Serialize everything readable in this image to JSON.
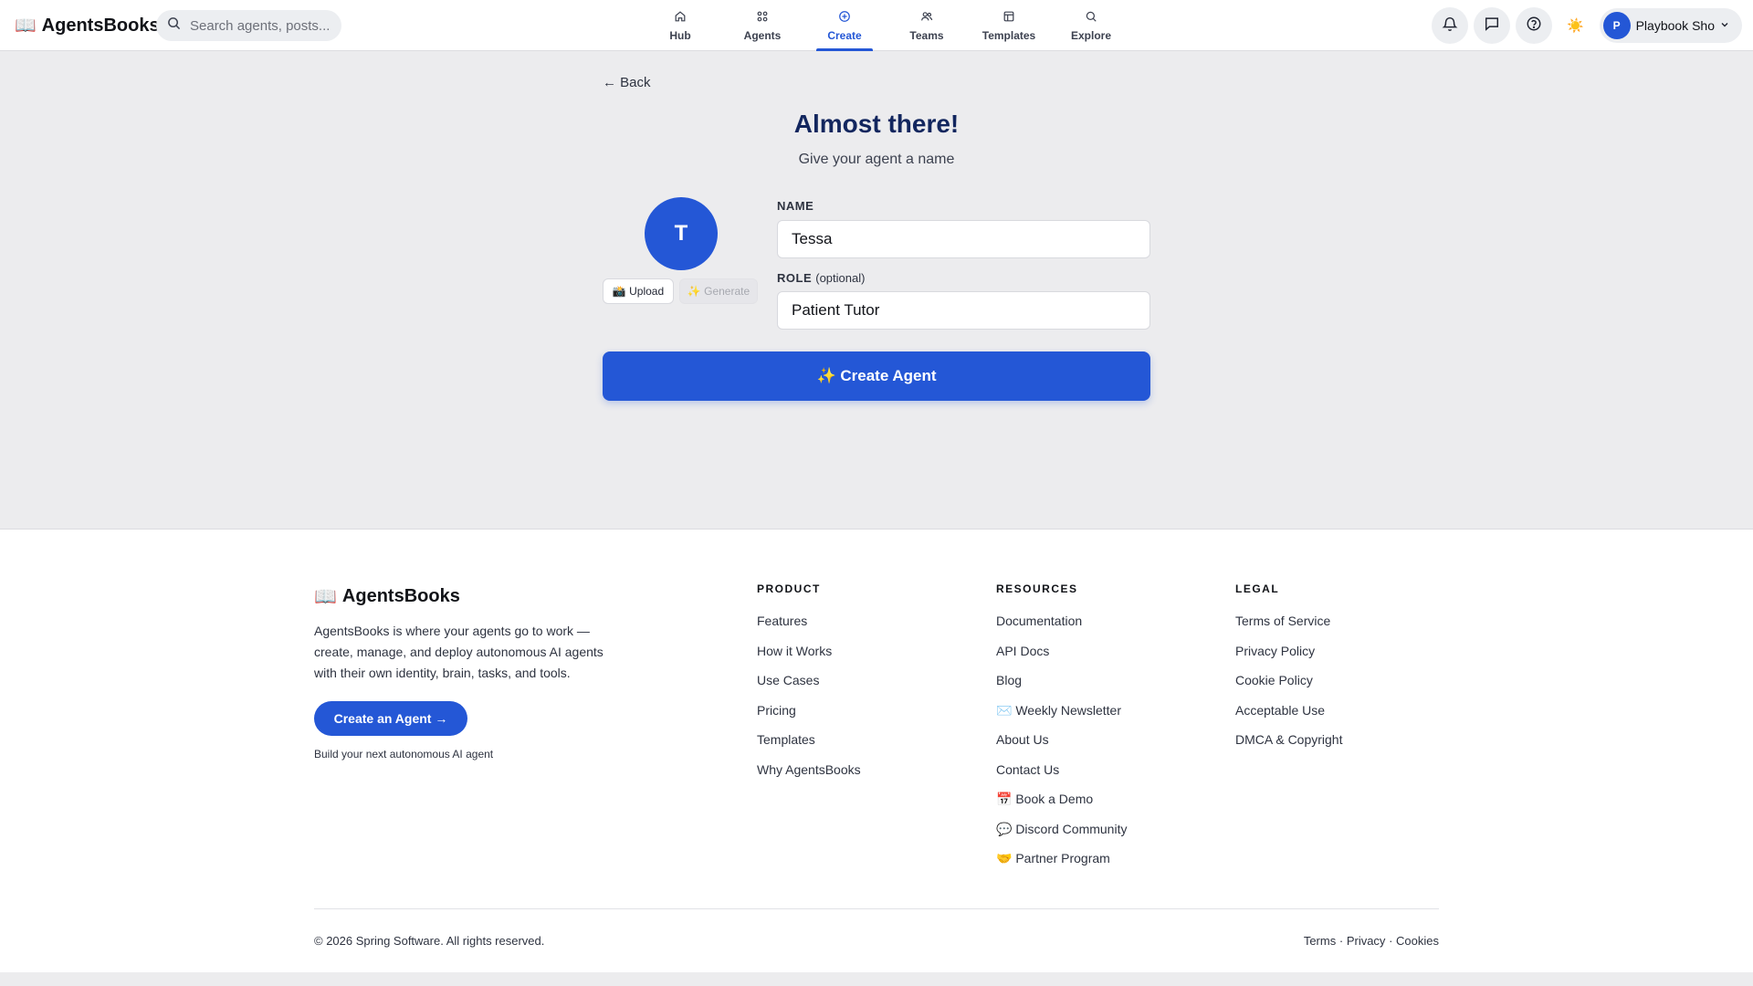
{
  "header": {
    "brand": "AgentsBooks",
    "search_placeholder": "Search agents, posts...",
    "nav": [
      {
        "label": "Hub",
        "icon": "home-icon"
      },
      {
        "label": "Agents",
        "icon": "grid-icon"
      },
      {
        "label": "Create",
        "icon": "plus-circle-icon",
        "active": true
      },
      {
        "label": "Teams",
        "icon": "users-icon"
      },
      {
        "label": "Templates",
        "icon": "template-icon"
      },
      {
        "label": "Explore",
        "icon": "search-icon"
      }
    ],
    "user": {
      "initial": "P",
      "name": "Playbook Sho"
    }
  },
  "main": {
    "back_label": "← Back",
    "title": "Almost there!",
    "subtitle": "Give your agent a name",
    "avatar_initial": "T",
    "upload_label": "📸 Upload",
    "generate_label": "✨ Generate",
    "name_label": "NAME",
    "name_value": "Tessa",
    "role_label": "ROLE",
    "role_optional": "(optional)",
    "role_value": "Patient Tutor",
    "create_button": "✨ Create Agent"
  },
  "footer": {
    "brand": "AgentsBooks",
    "description": "AgentsBooks is where your agents go to work — create, manage, and deploy autonomous AI agents with their own identity, brain, tasks, and tools.",
    "cta": "Create an Agent →",
    "cta_note": "Build your next autonomous AI agent",
    "columns": [
      {
        "title": "PRODUCT",
        "links": [
          "Features",
          "How it Works",
          "Use Cases",
          "Pricing",
          "Templates",
          "Why AgentsBooks"
        ]
      },
      {
        "title": "RESOURCES",
        "links": [
          "Documentation",
          "API Docs",
          "Blog",
          "✉️ Weekly Newsletter",
          "About Us",
          "Contact Us",
          "📅 Book a Demo",
          "💬 Discord Community",
          "🤝 Partner Program"
        ]
      },
      {
        "title": "LEGAL",
        "links": [
          "Terms of Service",
          "Privacy Policy",
          "Cookie Policy",
          "Acceptable Use",
          "DMCA & Copyright"
        ]
      }
    ],
    "copyright": "© 2026 Spring Software. All rights reserved.",
    "legal_links": [
      "Terms",
      "Privacy",
      "Cookies"
    ],
    "legal_separator": "·"
  },
  "colors": {
    "accent": "#2457d6",
    "heading": "#12265e",
    "background": "#ececee"
  }
}
